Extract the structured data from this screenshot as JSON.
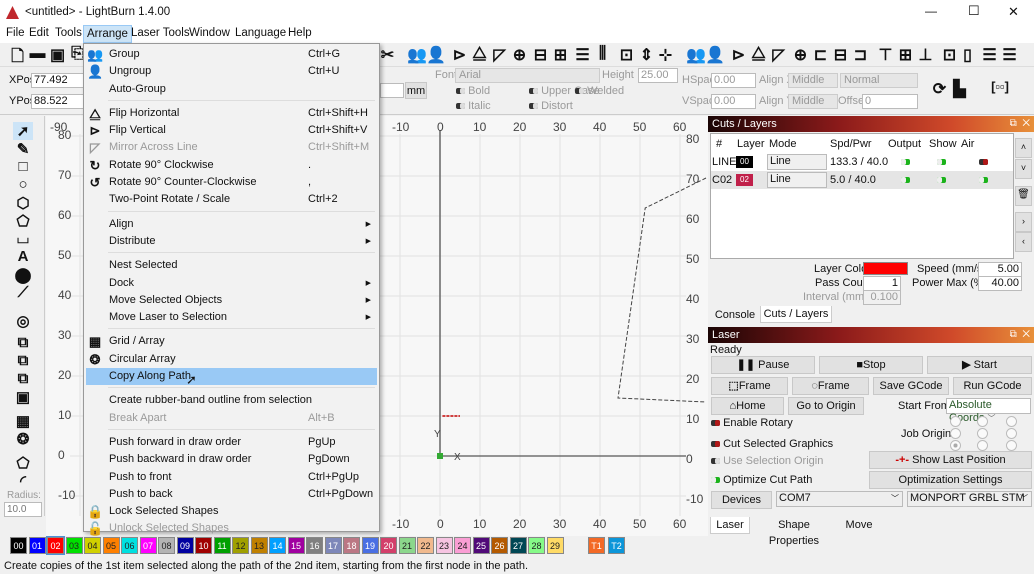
{
  "window": {
    "title": "<untitled> - LightBurn 1.4.00",
    "minimize": "—",
    "maximize": "☐",
    "close": "✕"
  },
  "menubar": [
    "File",
    "Edit",
    "Tools",
    "Arrange",
    "Laser Tools",
    "Window",
    "Language",
    "Help"
  ],
  "props": {
    "xpos_label": "XPos",
    "xpos": "77.492",
    "ypos_label": "YPos",
    "ypos": "88.522",
    "unit": "mm",
    "font_label": "Font",
    "font": "Arial",
    "height_label": "Height",
    "height": "25.00",
    "bold": "Bold",
    "italic": "Italic",
    "upper_case": "Upper Case",
    "distort": "Distort",
    "welded": "Welded",
    "hspace_label": "HSpace",
    "hspace": "0.00",
    "vspace_label": "VSpace",
    "vspace": "0.00",
    "alignx_label": "Align X",
    "alignx": "Middle",
    "aligny_label": "Align Y",
    "aligny": "Middle",
    "normal": "Normal",
    "offset_label": "Offset",
    "offset": "0"
  },
  "left_tools": {
    "radius_label": "Radius:",
    "radius": "10.0"
  },
  "rulers": {
    "top": [
      "-90",
      "-10",
      "0",
      "10",
      "20",
      "30",
      "40",
      "50",
      "60"
    ],
    "left": [
      "80",
      "70",
      "60",
      "50",
      "40",
      "30",
      "20",
      "10",
      "0",
      "-10"
    ],
    "right": [
      "80",
      "70",
      "60",
      "50",
      "40",
      "30",
      "20",
      "10",
      "0",
      "-10"
    ],
    "axis_x": "X",
    "axis_y": "Y"
  },
  "menu": [
    {
      "label": "Group",
      "shortcut": "Ctrl+G",
      "icon": "group-icon"
    },
    {
      "label": "Ungroup",
      "shortcut": "Ctrl+U",
      "icon": "ungroup-icon"
    },
    {
      "label": "Auto-Group"
    },
    {
      "sep": true
    },
    {
      "label": "Flip Horizontal",
      "shortcut": "Ctrl+Shift+H",
      "icon": "flip-horizontal-icon"
    },
    {
      "label": "Flip Vertical",
      "shortcut": "Ctrl+Shift+V",
      "icon": "flip-vertical-icon"
    },
    {
      "label": "Mirror Across Line",
      "shortcut": "Ctrl+Shift+M",
      "icon": "mirror-icon",
      "disabled": true
    },
    {
      "label": "Rotate 90° Clockwise",
      "shortcut": ".",
      "icon": "rotate-cw-icon"
    },
    {
      "label": "Rotate 90° Counter-Clockwise",
      "shortcut": ",",
      "icon": "rotate-ccw-icon"
    },
    {
      "label": "Two-Point Rotate / Scale",
      "shortcut": "Ctrl+2"
    },
    {
      "sep": true
    },
    {
      "label": "Align",
      "submenu": true
    },
    {
      "label": "Distribute",
      "submenu": true
    },
    {
      "sep": true
    },
    {
      "label": "Nest Selected"
    },
    {
      "label": "Dock",
      "submenu": true
    },
    {
      "label": "Move Selected Objects",
      "submenu": true
    },
    {
      "label": "Move Laser to Selection",
      "submenu": true
    },
    {
      "sep": true
    },
    {
      "label": "Grid / Array",
      "icon": "grid-array-icon"
    },
    {
      "label": "Circular Array",
      "icon": "circular-array-icon"
    },
    {
      "label": "Copy Along Path",
      "highlighted": true
    },
    {
      "sep": true
    },
    {
      "label": "Create rubber-band outline from selection"
    },
    {
      "label": "Break Apart",
      "shortcut": "Alt+B",
      "disabled": true
    },
    {
      "sep": true
    },
    {
      "label": "Push forward in draw order",
      "shortcut": "PgUp"
    },
    {
      "label": "Push backward in draw order",
      "shortcut": "PgDown"
    },
    {
      "label": "Push to front",
      "shortcut": "Ctrl+PgUp"
    },
    {
      "label": "Push to back",
      "shortcut": "Ctrl+PgDown"
    },
    {
      "label": "Lock Selected Shapes",
      "icon": "lock-icon"
    },
    {
      "label": "Unlock Selected Shapes",
      "icon": "unlock-icon",
      "disabled": true
    }
  ],
  "cuts": {
    "title": "Cuts / Layers",
    "headers": [
      "#",
      "Layer",
      "Mode",
      "Spd/Pwr",
      "Output",
      "Show",
      "Air"
    ],
    "rows": [
      {
        "num": "LINE",
        "layer": "00",
        "color": "#000000",
        "mode": "Line",
        "spdpwr": "133.3 / 40.0",
        "output": true,
        "show": true,
        "air": false
      },
      {
        "num": "C02",
        "layer": "02",
        "color": "#c0204a",
        "mode": "Line",
        "spdpwr": "5.0 / 40.0",
        "output": true,
        "show": true,
        "air": true
      }
    ],
    "layer_color_label": "Layer Color",
    "layer_color": "#ff0000",
    "speed_label": "Speed (mm/s)",
    "speed": "5.00",
    "pass_label": "Pass Count",
    "pass": "1",
    "power_label": "Power Max (%)",
    "power": "40.00",
    "interval_label": "Interval (mm)",
    "interval": "0.100",
    "tabs": [
      "Console",
      "Cuts / Layers"
    ]
  },
  "laser": {
    "title": "Laser",
    "status": "Ready",
    "pause": "Pause",
    "stop": "Stop",
    "start": "Start",
    "frame1": "Frame",
    "frame2": "Frame",
    "save_gcode": "Save GCode",
    "run_gcode": "Run GCode",
    "home": "Home",
    "go_origin": "Go to Origin",
    "start_from_label": "Start From:",
    "start_from": "Absolute Coords",
    "enable_rotary": "Enable Rotary",
    "cut_selected": "Cut Selected Graphics",
    "use_sel_origin": "Use Selection Origin",
    "optimize": "Optimize Cut Path",
    "job_origin_label": "Job Origin",
    "show_last": "Show Last Position",
    "opt_settings": "Optimization Settings",
    "devices": "Devices",
    "port": "COM7",
    "device": "MONPORT GRBL STM",
    "tabs": [
      "Laser",
      "Shape Properties",
      "Move"
    ]
  },
  "palette": [
    {
      "l": "00",
      "c": "#000000"
    },
    {
      "l": "01",
      "c": "#0000ff"
    },
    {
      "l": "02",
      "c": "#ff0000"
    },
    {
      "l": "03",
      "c": "#00e000"
    },
    {
      "l": "04",
      "c": "#d0d000"
    },
    {
      "l": "05",
      "c": "#ff8000"
    },
    {
      "l": "06",
      "c": "#00e0e0"
    },
    {
      "l": "07",
      "c": "#ff00ff"
    },
    {
      "l": "08",
      "c": "#b4b4b4"
    },
    {
      "l": "09",
      "c": "#0000a0"
    },
    {
      "l": "10",
      "c": "#a00000"
    },
    {
      "l": "11",
      "c": "#00a000"
    },
    {
      "l": "12",
      "c": "#a0a000"
    },
    {
      "l": "13",
      "c": "#c08000"
    },
    {
      "l": "14",
      "c": "#00a0ff"
    },
    {
      "l": "15",
      "c": "#a000a0"
    },
    {
      "l": "16",
      "c": "#808080"
    },
    {
      "l": "17",
      "c": "#7d87b9"
    },
    {
      "l": "18",
      "c": "#bb7784"
    },
    {
      "l": "19",
      "c": "#4a6fe3"
    },
    {
      "l": "20",
      "c": "#d33f6a"
    },
    {
      "l": "21",
      "c": "#8cd78c"
    },
    {
      "l": "22",
      "c": "#f0b98d"
    },
    {
      "l": "23",
      "c": "#f6c4e1"
    },
    {
      "l": "24",
      "c": "#fa9ed4"
    },
    {
      "l": "25",
      "c": "#500a78"
    },
    {
      "l": "26",
      "c": "#b45a00"
    },
    {
      "l": "27",
      "c": "#004754"
    },
    {
      "l": "28",
      "c": "#86fa88"
    },
    {
      "l": "29",
      "c": "#ffdb66"
    },
    {
      "l": "T1",
      "c": "#f36926"
    },
    {
      "l": "T2",
      "c": "#0c96d9"
    }
  ],
  "status": "Create copies of the 1st item selected along the path of the 2nd item, starting from the first node in the path."
}
